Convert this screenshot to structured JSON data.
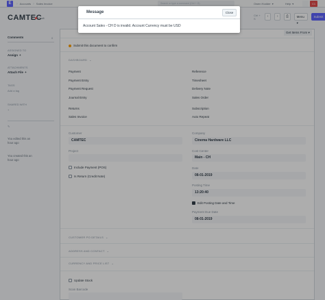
{
  "navbar": {
    "logo": "E",
    "breadcrumbs": [
      "Accounts",
      "Sales Invoice"
    ],
    "search_placeholder": "Search or type a command (Ctrl + G)",
    "user": "Owen Hodder",
    "help": "Help",
    "avatar_initials": "C1"
  },
  "page": {
    "title": "CAMTEC",
    "status": "Draft",
    "prev_next": "Ctrl + S",
    "menu_label": "Menu",
    "submit_label": "Submit"
  },
  "sidebar": {
    "comments": "Comments",
    "comments_count": "0",
    "assigned_to": "ASSIGNED TO",
    "assign": "Assign",
    "attachments": "ATTACHMENTS",
    "attach_file": "Attach File",
    "tags": "TAGS",
    "add_tag": "Add a tag",
    "share": "SHARED WITH",
    "activity_1": "You edited this an hour ago",
    "activity_2": "You created this an hour ago"
  },
  "form": {
    "get_items": "Get Items From",
    "alert": "Submit this document to confirm",
    "dashboard": "DASHBOARD",
    "dash_left": [
      "Payment",
      "Payment Entry",
      "Payment Request",
      "Journal Entry",
      "Returns",
      "Sales Invoice"
    ],
    "dash_right": [
      "Reference",
      "Timesheet",
      "Delivery Note",
      "Sales Order",
      "Subscription",
      "Auto Repeat"
    ],
    "customer_label": "Customer",
    "customer_value": "CAMTEC",
    "project_label": "Project",
    "include_payment": "Include Payment (POS)",
    "is_return": "Is Return (Credit Note)",
    "company_label": "Company",
    "company_value": "Cinema Hardware LLC",
    "cost_center_label": "Cost Center",
    "cost_center_value": "Main - CH",
    "date_label": "Date",
    "date_value": "08-01-2019",
    "posting_time_label": "Posting Time",
    "posting_time_value": "13:20:40",
    "edit_posting": "Edit Posting Date and Time",
    "due_date_label": "Payment Due Date",
    "due_date_value": "08-01-2019",
    "sec_customer_po": "CUSTOMER PO DETAILS",
    "sec_address": "ADDRESS AND CONTACT",
    "sec_currency": "CURRENCY AND PRICE LIST",
    "update_stock": "Update Stock",
    "scan_barcode": "Scan Barcode"
  },
  "modal": {
    "title": "Message",
    "close_label": "Close",
    "message": "Account Sales - CH D is invalid. Account Currency must be USD"
  },
  "colors": {
    "primary": "#5e64ff",
    "draft_dot": "#ff5858",
    "alert_dot": "#ffa00a"
  }
}
